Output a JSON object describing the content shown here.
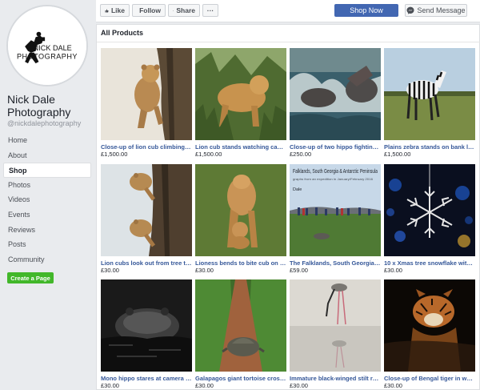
{
  "page": {
    "name": "Nick Dale Photography",
    "handle": "@nickdalephotography",
    "logo_line1": "NICK DALE",
    "logo_line2": "PHOTOGRAPHY"
  },
  "nav": [
    {
      "label": "Home"
    },
    {
      "label": "About"
    },
    {
      "label": "Shop",
      "active": true
    },
    {
      "label": "Photos"
    },
    {
      "label": "Videos"
    },
    {
      "label": "Events"
    },
    {
      "label": "Reviews"
    },
    {
      "label": "Posts"
    },
    {
      "label": "Community"
    }
  ],
  "create_page_label": "Create a Page",
  "toolbar": {
    "like_label": "Like",
    "follow_label": "Follow",
    "share_label": "Share",
    "more_label": "···",
    "shop_now_label": "Shop Now",
    "send_message_label": "Send Message"
  },
  "section_title": "All Products",
  "colors": {
    "brand_blue": "#4267b2",
    "link_blue": "#365899",
    "green": "#42b72a"
  },
  "products": [
    {
      "title": "Close-up of lion cub climbing t...",
      "price": "£1,500.00",
      "scene": "lion-cub-tree"
    },
    {
      "title": "Lion cub stands watching cam...",
      "price": "£1,500.00",
      "scene": "lion-cub-grass"
    },
    {
      "title": "Close-up of two hippo fighting...",
      "price": "£250.00",
      "scene": "hippo-water"
    },
    {
      "title": "Plains zebra stands on bank lo...",
      "price": "£1,500.00",
      "scene": "zebra"
    },
    {
      "title": "Lion cubs look out from tree tr...",
      "price": "£30.00",
      "scene": "lion-cubs-tree"
    },
    {
      "title": "Lioness bends to bite cub on n...",
      "price": "£30.00",
      "scene": "lioness"
    },
    {
      "title": "The Falklands, South Georgia ...",
      "price": "£59.00",
      "scene": "falklands",
      "overlay_title": "Falklands, South Georgia & Antarctic Peninsula",
      "overlay_sub": "graphs from an expedition in January/February 2016",
      "overlay_author": "Dale"
    },
    {
      "title": "10 x Xmas tree snowflake with ...",
      "price": "£30.00",
      "scene": "snowflake"
    },
    {
      "title": "Mono hippo stares at camera f...",
      "price": "£30.00",
      "scene": "mono-hippo"
    },
    {
      "title": "Galapagos giant tortoise cross...",
      "price": "£30.00",
      "scene": "tortoise"
    },
    {
      "title": "Immature black-winged stilt re...",
      "price": "£30.00",
      "scene": "stilt"
    },
    {
      "title": "Close-up of Bengal tiger in wat...",
      "price": "£30.00",
      "scene": "tiger"
    }
  ]
}
